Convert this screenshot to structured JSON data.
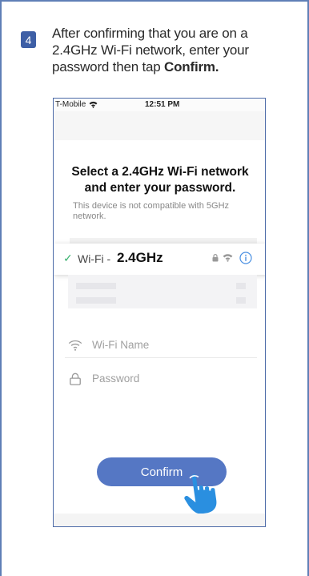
{
  "step": {
    "number": "4"
  },
  "instruction": {
    "text": "After confirming that you are on a 2.4GHz Wi-Fi network, enter your password then tap ",
    "bold": "Confirm."
  },
  "phone": {
    "status": {
      "carrier": "T-Mobile",
      "time": "12:51 PM"
    },
    "title_line1": "Select a 2.4GHz  Wi-Fi network",
    "title_line2": "and enter your password.",
    "subtext": "This device is not compatible with 5GHz network.",
    "wifi_row": {
      "label": "Wi-Fi - ",
      "band": "2.4GHz"
    },
    "wifi_name_placeholder": "Wi-Fi Name",
    "password_placeholder": "Password",
    "confirm_label": "Confirm"
  },
  "colors": {
    "frame": "#5f7fb6",
    "badge": "#3e5fa6",
    "button": "#5577c4",
    "check": "#3cb371",
    "info": "#4a90e2",
    "hand": "#2a8fe0"
  }
}
